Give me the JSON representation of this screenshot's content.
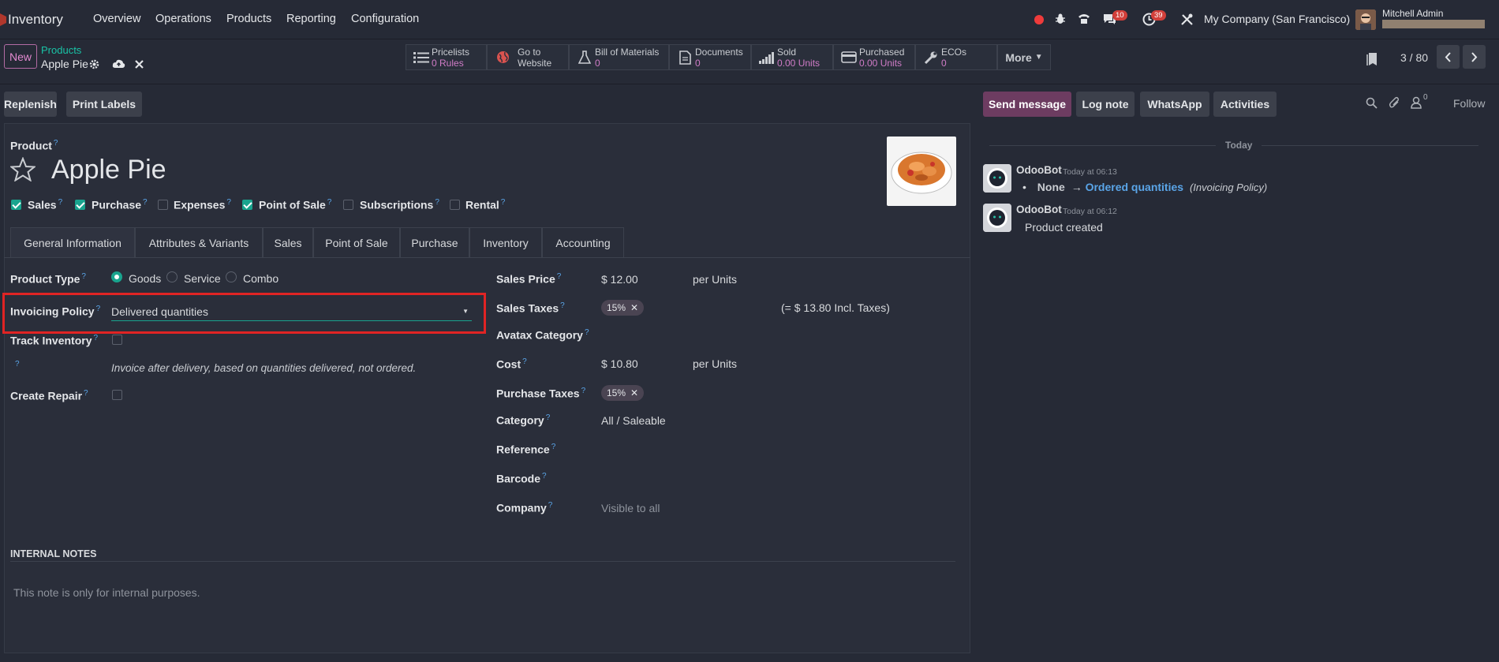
{
  "nav": {
    "app_name": "Inventory",
    "menu": [
      "Overview",
      "Operations",
      "Products",
      "Reporting",
      "Configuration"
    ],
    "messages_badge": "10",
    "activities_badge": "39",
    "company": "My Company (San Francisco)",
    "user": "Mitchell Admin"
  },
  "control": {
    "new_label": "New",
    "breadcrumb_parent": "Products",
    "record_name": "Apple Pie",
    "pager": "3 / 80",
    "smart_buttons": [
      {
        "title": "Pricelists",
        "value": "0 Rules",
        "icon": "list-icon"
      },
      {
        "title": "Go to",
        "value": "Website",
        "icon": "globe-icon"
      },
      {
        "title": "Bill of Materials",
        "value": "0",
        "icon": "flask-icon"
      },
      {
        "title": "Documents",
        "value": "0",
        "icon": "file-icon"
      },
      {
        "title": "Sold",
        "value": "0.00 Units",
        "icon": "signal-icon"
      },
      {
        "title": "Purchased",
        "value": "0.00 Units",
        "icon": "credit-card-icon"
      },
      {
        "title": "ECOs",
        "value": "0",
        "icon": "wrench-icon"
      }
    ],
    "more_label": "More"
  },
  "actions": {
    "replenish": "Replenish",
    "print_labels": "Print Labels",
    "send_message": "Send message",
    "log_note": "Log note",
    "whatsapp": "WhatsApp",
    "activities": "Activities",
    "followers_count": "0",
    "follow": "Follow"
  },
  "form": {
    "product_label": "Product",
    "product_name": "Apple Pie",
    "flags": [
      {
        "label": "Sales",
        "checked": true
      },
      {
        "label": "Purchase",
        "checked": true
      },
      {
        "label": "Expenses",
        "checked": false
      },
      {
        "label": "Point of Sale",
        "checked": true
      },
      {
        "label": "Subscriptions",
        "checked": false
      },
      {
        "label": "Rental",
        "checked": false
      }
    ],
    "tabs": [
      "General Information",
      "Attributes & Variants",
      "Sales",
      "Point of Sale",
      "Purchase",
      "Inventory",
      "Accounting"
    ],
    "product_type_label": "Product Type",
    "product_type_options": [
      "Goods",
      "Service",
      "Combo"
    ],
    "invoicing_policy_label": "Invoicing Policy",
    "invoicing_policy_value": "Delivered quantities",
    "track_inventory_label": "Track Inventory",
    "invoice_hint": "Invoice after delivery, based on quantities delivered, not ordered.",
    "create_repair_label": "Create Repair",
    "sales_price_label": "Sales Price",
    "sales_price": "$ 12.00",
    "per_units": "per Units",
    "sales_taxes_label": "Sales Taxes",
    "sales_tax": "15%",
    "incl_taxes": "(= $ 13.80 Incl. Taxes)",
    "avatax_label": "Avatax Category",
    "cost_label": "Cost",
    "cost": "$ 10.80",
    "purchase_taxes_label": "Purchase Taxes",
    "purchase_tax": "15%",
    "category_label": "Category",
    "category": "All / Saleable",
    "reference_label": "Reference",
    "barcode_label": "Barcode",
    "company_label": "Company",
    "company_placeholder": "Visible to all",
    "internal_notes_label": "INTERNAL NOTES",
    "internal_notes_placeholder": "This note is only for internal purposes."
  },
  "chatter": {
    "date_separator": "Today",
    "messages": [
      {
        "author": "OdooBot",
        "time": "Today at 06:13",
        "old_value": "None",
        "new_value": "Ordered quantities",
        "field": "(Invoicing Policy)"
      },
      {
        "author": "OdooBot",
        "time": "Today at 06:12",
        "body": "Product created"
      }
    ]
  },
  "colors": {
    "accent": "#19a48e",
    "brand": "#6d3c61",
    "highlight_box": "#e02424",
    "link": "#5aa5e8"
  }
}
